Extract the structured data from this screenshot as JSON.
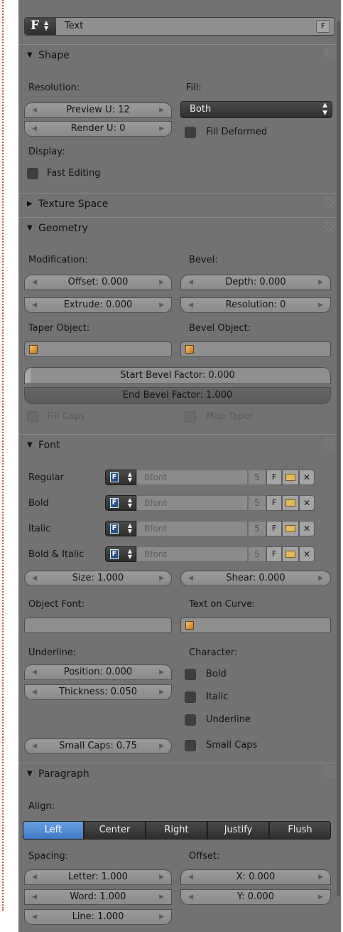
{
  "header": {
    "icon_letter": "F",
    "datablock_name": "Text",
    "fake_user": "F"
  },
  "shape": {
    "title": "Shape",
    "resolution_label": "Resolution:",
    "preview_u": "Preview U: 12",
    "render_u": "Render U: 0",
    "fill_label": "Fill:",
    "fill_value": "Both",
    "fill_deformed": "Fill Deformed",
    "display_label": "Display:",
    "fast_editing": "Fast Editing"
  },
  "texture_space": {
    "title": "Texture Space"
  },
  "geometry": {
    "title": "Geometry",
    "modification_label": "Modification:",
    "offset": "Offset: 0.000",
    "extrude": "Extrude: 0.000",
    "bevel_label": "Bevel:",
    "depth": "Depth: 0.000",
    "resolution": "Resolution: 0",
    "taper_object_label": "Taper Object:",
    "bevel_object_label": "Bevel Object:",
    "start_bevel_factor": "Start Bevel Factor: 0.000",
    "end_bevel_factor": "End Bevel Factor: 1.000",
    "fill_caps": "Fill Caps",
    "map_taper": "Map Taper"
  },
  "font": {
    "title": "Font",
    "rows": [
      {
        "label": "Regular",
        "name": "Bfont",
        "users": "5",
        "f": "F"
      },
      {
        "label": "Bold",
        "name": "Bfont",
        "users": "5",
        "f": "F"
      },
      {
        "label": "Italic",
        "name": "Bfont",
        "users": "5",
        "f": "F"
      },
      {
        "label": "Bold & Italic",
        "name": "Bfont",
        "users": "5",
        "f": "F"
      }
    ],
    "size": "Size: 1.000",
    "shear": "Shear: 0.000",
    "object_font_label": "Object Font:",
    "text_on_curve_label": "Text on Curve:",
    "underline_label": "Underline:",
    "position": "Position: 0.000",
    "thickness": "Thickness: 0.050",
    "character_label": "Character:",
    "bold": "Bold",
    "italic": "Italic",
    "underline": "Underline",
    "small_caps": "Small Caps",
    "small_caps_scale": "Small Caps: 0.75"
  },
  "paragraph": {
    "title": "Paragraph",
    "align_label": "Align:",
    "align_options": [
      "Left",
      "Center",
      "Right",
      "Justify",
      "Flush"
    ],
    "align_selected": "Left",
    "spacing_label": "Spacing:",
    "letter": "Letter: 1.000",
    "word": "Word: 1.000",
    "line": "Line: 1.000",
    "offset_label": "Offset:",
    "x": "X: 0.000",
    "y": "Y: 0.000"
  },
  "colors": {
    "panel_bg": "#727272",
    "active_blue": "#4178c7",
    "dark_button": "#303030"
  }
}
